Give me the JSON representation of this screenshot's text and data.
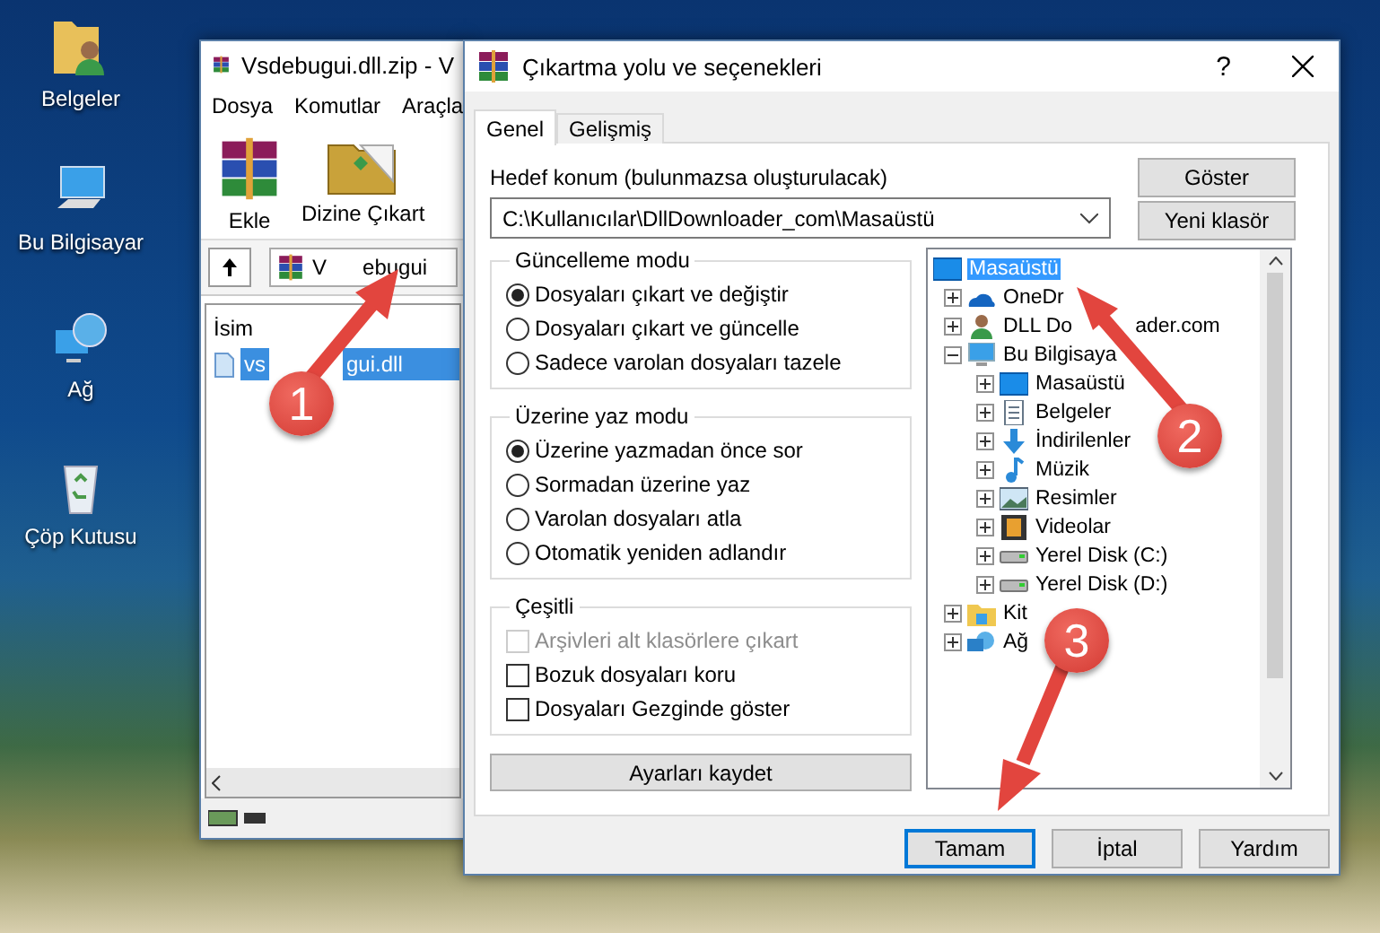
{
  "desktop_icons": [
    {
      "kind": "folder",
      "label": "Belgeler"
    },
    {
      "kind": "computer",
      "label": "Bu Bilgisayar"
    },
    {
      "kind": "network",
      "label": "Ağ"
    },
    {
      "kind": "recycle",
      "label": "Çöp Kutusu"
    }
  ],
  "archive_window": {
    "title": "Vsdebugui.dll.zip - V",
    "menu": [
      "Dosya",
      "Komutlar",
      "Araçla"
    ],
    "toolbar": [
      {
        "kind": "add",
        "label": "Ekle"
      },
      {
        "kind": "extract",
        "label": "Dizine Çıkart"
      }
    ],
    "address": {
      "head": "V",
      "tail": "ebugui"
    },
    "column": "İsim",
    "files": [
      {
        "head": "vs",
        "tail": "gui.dll",
        "selected": true
      }
    ]
  },
  "dialog": {
    "title": "Çıkartma yolu ve seçenekleri",
    "help": "?",
    "tabs": [
      {
        "label": "Genel",
        "selected": true
      },
      {
        "label": "Gelişmiş",
        "selected": false
      }
    ],
    "destination": {
      "label": "Hedef konum (bulunmazsa oluşturulacak)",
      "value": "C:\\Kullanıcılar\\DllDownloader_com\\Masaüstü"
    },
    "side_buttons": [
      "Göster",
      "Yeni klasör"
    ],
    "groups": [
      {
        "title": "Güncelleme modu",
        "options": [
          {
            "kind": "radio",
            "label": "Dosyaları çıkart ve değiştir",
            "checked": true,
            "disabled": false
          },
          {
            "kind": "radio",
            "label": "Dosyaları çıkart ve güncelle",
            "checked": false,
            "disabled": false
          },
          {
            "kind": "radio",
            "label": "Sadece varolan dosyaları tazele",
            "checked": false,
            "disabled": false
          }
        ]
      },
      {
        "title": "Üzerine yaz modu",
        "options": [
          {
            "kind": "radio",
            "label": "Üzerine yazmadan önce sor",
            "checked": true,
            "disabled": false
          },
          {
            "kind": "radio",
            "label": "Sormadan üzerine yaz",
            "checked": false,
            "disabled": false
          },
          {
            "kind": "radio",
            "label": "Varolan dosyaları atla",
            "checked": false,
            "disabled": false
          },
          {
            "kind": "radio",
            "label": "Otomatik yeniden adlandır",
            "checked": false,
            "disabled": false
          }
        ]
      },
      {
        "title": "Çeşitli",
        "options": [
          {
            "kind": "checkbox",
            "label": "Arşivleri alt klasörlere çıkart",
            "checked": false,
            "disabled": true
          },
          {
            "kind": "checkbox",
            "label": "Bozuk dosyaları koru",
            "checked": false,
            "disabled": false
          },
          {
            "kind": "checkbox",
            "label": "Dosyaları Gezginde göster",
            "checked": false,
            "disabled": false
          }
        ]
      }
    ],
    "save_button": "Ayarları kaydet",
    "tree": [
      {
        "kind": "desktop",
        "label": "Masaüstü",
        "selected": true,
        "children": [
          {
            "kind": "cloud",
            "label": "OneDr",
            "selected": false,
            "expanded": false
          },
          {
            "kind": "user",
            "label": "DLL Do",
            "tail": "ader.com",
            "selected": false,
            "expanded": false
          },
          {
            "kind": "computer",
            "label": "Bu Bilgisaya",
            "selected": false,
            "expanded": true,
            "children": [
              {
                "kind": "desktop",
                "label": "Masaüstü",
                "selected": false,
                "expanded": false
              },
              {
                "kind": "document",
                "label": "Belgeler",
                "selected": false,
                "expanded": false
              },
              {
                "kind": "download",
                "label": "İndirilenler",
                "selected": false,
                "expanded": false
              },
              {
                "kind": "music",
                "label": "Müzik",
                "selected": false,
                "expanded": false
              },
              {
                "kind": "picture",
                "label": "Resimler",
                "selected": false,
                "expanded": false
              },
              {
                "kind": "video",
                "label": "Videolar",
                "selected": false,
                "expanded": false
              },
              {
                "kind": "disk",
                "label": "Yerel Disk (C:)",
                "selected": false,
                "expanded": false
              },
              {
                "kind": "disk",
                "label": "Yerel Disk (D:)",
                "selected": false,
                "expanded": false
              }
            ]
          },
          {
            "kind": "library",
            "label": "Kit",
            "selected": false,
            "expanded": false
          },
          {
            "kind": "network",
            "label": "Ağ",
            "selected": false,
            "expanded": false
          }
        ]
      }
    ],
    "buttons": [
      {
        "label": "Tamam",
        "default": true
      },
      {
        "label": "İptal",
        "default": false
      },
      {
        "label": "Yardım",
        "default": false
      }
    ]
  },
  "callouts": [
    {
      "number": "1"
    },
    {
      "number": "2"
    },
    {
      "number": "3"
    }
  ]
}
